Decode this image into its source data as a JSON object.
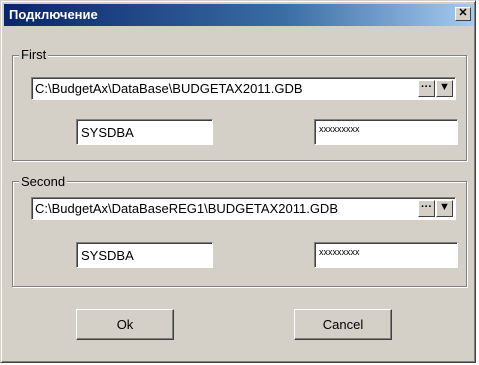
{
  "window": {
    "title": "Подключение",
    "close_glyph": "✕"
  },
  "first": {
    "label": "First",
    "path": "C:\\BudgetAx\\DataBase\\BUDGETAX2011.GDB",
    "user": "SYSDBA",
    "password_mask": "xxxxxxxxx"
  },
  "second": {
    "label": "Second",
    "path": "C:\\BudgetAx\\DataBaseREG1\\BUDGETAX2011.GDB",
    "user": "SYSDBA",
    "password_mask": "xxxxxxxxx"
  },
  "icons": {
    "browse": "···",
    "dropdown": "▼"
  },
  "buttons": {
    "ok": "Ok",
    "cancel": "Cancel"
  }
}
